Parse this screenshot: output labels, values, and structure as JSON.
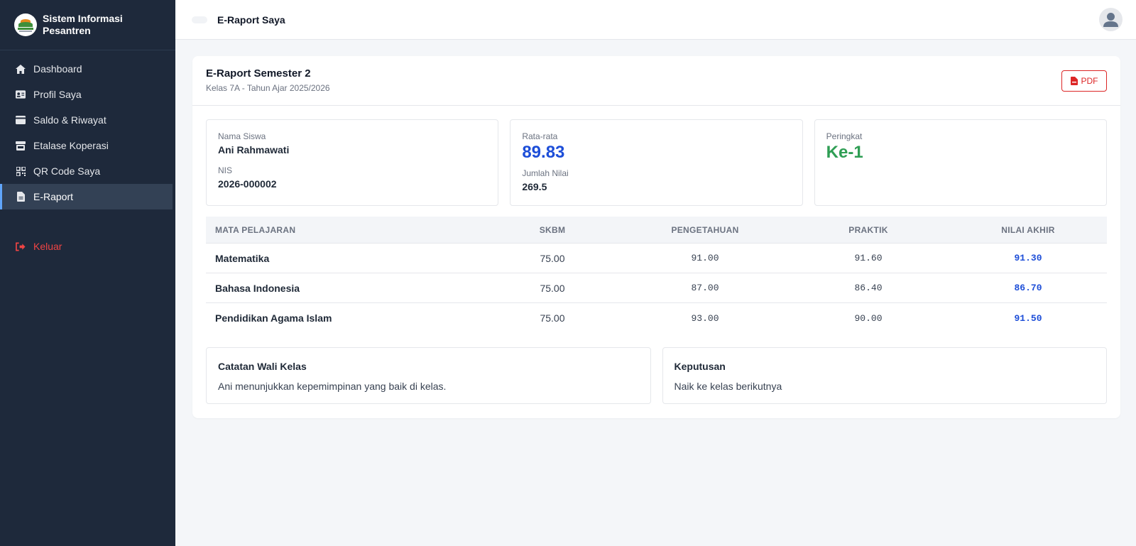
{
  "sidebar": {
    "brand": "Sistem Informasi Pesantren",
    "items": [
      {
        "label": "Dashboard",
        "icon": "home-icon"
      },
      {
        "label": "Profil Saya",
        "icon": "id-card-icon"
      },
      {
        "label": "Saldo & Riwayat",
        "icon": "wallet-icon"
      },
      {
        "label": "Etalase Koperasi",
        "icon": "store-icon"
      },
      {
        "label": "QR Code Saya",
        "icon": "qrcode-icon"
      },
      {
        "label": "E-Raport",
        "icon": "file-icon",
        "active": true
      }
    ],
    "logout": "Keluar"
  },
  "topbar": {
    "title": "E-Raport Saya"
  },
  "report": {
    "title": "E-Raport Semester 2",
    "subtitle": "Kelas 7A - Tahun Ajar 2025/2026",
    "pdf_label": "PDF",
    "student_name_label": "Nama Siswa",
    "student_name": "Ani Rahmawati",
    "nis_label": "NIS",
    "nis": "2026-000002",
    "average_label": "Rata-rata",
    "average": "89.83",
    "total_label": "Jumlah Nilai",
    "total": "269.5",
    "rank_label": "Peringkat",
    "rank": "Ke-1"
  },
  "table": {
    "headers": [
      "MATA PELAJARAN",
      "SKBM",
      "PENGETAHUAN",
      "PRAKTIK",
      "NILAI AKHIR"
    ],
    "rows": [
      {
        "subject": "Matematika",
        "skbm": "75.00",
        "pengetahuan": "91.00",
        "praktik": "91.60",
        "nilai_akhir": "91.30"
      },
      {
        "subject": "Bahasa Indonesia",
        "skbm": "75.00",
        "pengetahuan": "87.00",
        "praktik": "86.40",
        "nilai_akhir": "86.70"
      },
      {
        "subject": "Pendidikan Agama Islam",
        "skbm": "75.00",
        "pengetahuan": "93.00",
        "praktik": "90.00",
        "nilai_akhir": "91.50"
      }
    ]
  },
  "notes": {
    "wali_title": "Catatan Wali Kelas",
    "wali_text": "Ani menunjukkan kepemimpinan yang baik di kelas.",
    "decision_title": "Keputusan",
    "decision_text": "Naik ke kelas berikutnya"
  },
  "colors": {
    "sidebar": "#1e293b",
    "accent_blue": "#1d4ed8",
    "accent_green": "#2f9e54",
    "danger": "#dc2626"
  }
}
